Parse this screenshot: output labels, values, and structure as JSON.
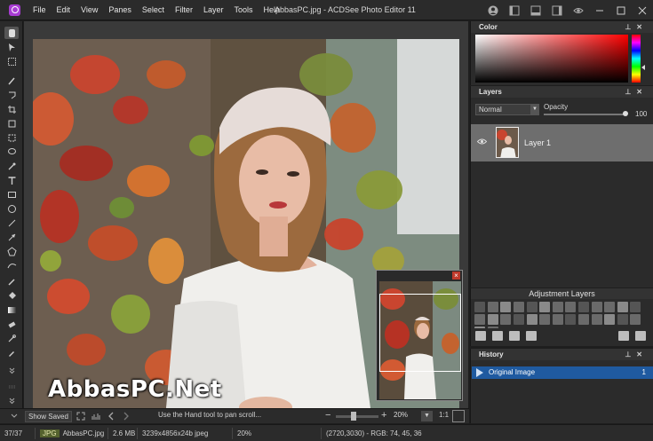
{
  "window": {
    "title": "AbbasPC.jpg - ACDSee Photo Editor 11"
  },
  "menu": [
    "File",
    "Edit",
    "View",
    "Panes",
    "Select",
    "Filter",
    "Layer",
    "Tools",
    "Help"
  ],
  "title_icons": [
    "account-icon",
    "layout-icon",
    "layout-alt-icon",
    "panel-icon",
    "eye-icon",
    "minimize-icon",
    "maximize-icon",
    "close-icon"
  ],
  "canvas": {
    "watermark": "AbbasPC.Net"
  },
  "canvas_status": {
    "show_saved": "Show Saved",
    "hint": "Use the Hand tool to pan scroll...",
    "zoom_minus": "−",
    "zoom_plus": "+",
    "zoom": "20%",
    "zoom_level": 0.2,
    "one_to_one": "1:1"
  },
  "statusbar": {
    "index": "37/37",
    "type": "JPG",
    "filename": "AbbasPC.jpg",
    "size": "2.6 MB",
    "dimensions": "3239x4856x24b jpeg",
    "zoom": "20%",
    "cursor": "(2720,3030) - RGB: 74, 45, 36"
  },
  "color_panel": {
    "title": "Color"
  },
  "layers_panel": {
    "title": "Layers",
    "blend_mode": "Normal",
    "opacity_label": "Opacity",
    "opacity_value": "100",
    "layer_name": "Layer 1"
  },
  "adjustment_panel": {
    "title": "Adjustment Layers"
  },
  "history_panel": {
    "title": "History",
    "item_label": "Original Image",
    "item_number": "1"
  },
  "colors": {
    "accent": "#a83cd2",
    "history_selected": "#1f5aa0",
    "navigator_close": "#c0392b"
  }
}
